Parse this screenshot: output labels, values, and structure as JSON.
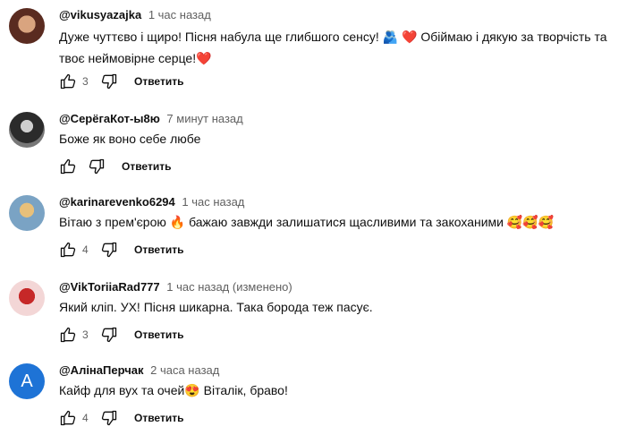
{
  "comments": [
    {
      "author": "@vikusyazajka",
      "time": "1 час назад",
      "line1_a": "Дуже чуттєво і щиро! Пісня набула ще глибшого сенсу! ",
      "line1_e1": "🫂",
      "line1_e2": "❤️",
      "line1_b": " Обіймаю і дякую за творчість та",
      "line2_a": "твоє неймовірне серце!",
      "line2_e": "❤️",
      "likes": "3",
      "reply": "Ответить"
    },
    {
      "author": "@СерёгаКот-ы8ю",
      "time": "7 минут назад",
      "line1_a": "Боже як воно себе любе",
      "reply": "Ответить"
    },
    {
      "author": "@karinarevenko6294",
      "time": "1 час назад",
      "line1_a": "Вітаю з прем'єрою ",
      "line1_e1": "🔥",
      "line1_b": " бажаю завжди залишатися щасливими та закоханими ",
      "line1_e2": "🥰🥰🥰",
      "likes": "4",
      "reply": "Ответить"
    },
    {
      "author": "@VikToriiaRad777",
      "time": "1 час назад (изменено)",
      "line1_a": "Який кліп. УХ! Пісня шикарна. Така борода теж пасує.",
      "likes": "3",
      "reply": "Ответить"
    },
    {
      "author": "@АлінаПерчак",
      "time": "2 часа назад",
      "avatar_letter": "A",
      "line1_a": "Кайф для вух та очей",
      "line1_e1": "😍",
      "line1_b": " Віталік, браво!",
      "likes": "4",
      "reply": "Ответить"
    }
  ],
  "icons": [
    "like-icon",
    "dislike-icon"
  ],
  "colors": {
    "avatar_a": "#1e73d6",
    "meta": "#606060"
  }
}
